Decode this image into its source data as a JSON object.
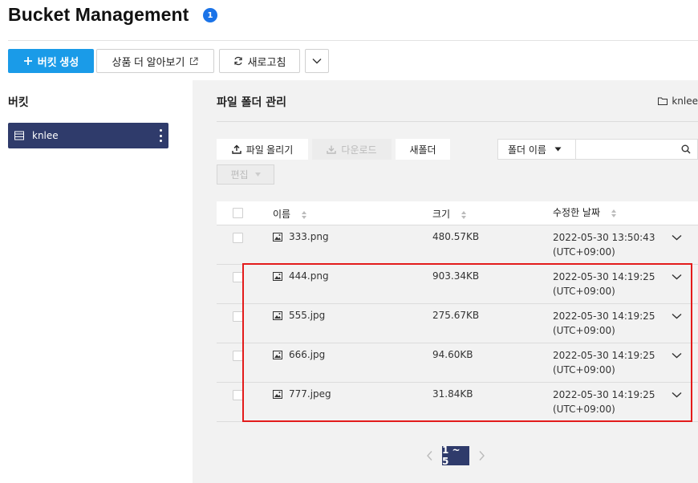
{
  "header": {
    "title": "Bucket Management",
    "badge": "1"
  },
  "toolbar": {
    "create_bucket": "버킷 생성",
    "learn_more": "상품 더 알아보기",
    "refresh": "새로고침"
  },
  "sidebar": {
    "title": "버킷",
    "buckets": [
      {
        "label": "knlee"
      }
    ]
  },
  "main": {
    "title": "파일 폴더 관리",
    "breadcrumb": "knlee",
    "actions": {
      "upload": "파일 올리기",
      "download": "다운로드",
      "new_folder": "새폴더",
      "edit": "편집"
    },
    "search": {
      "filter_label": "폴더 이름",
      "placeholder": ""
    }
  },
  "table": {
    "headers": {
      "name": "이름",
      "size": "크기",
      "modified": "수정한 날짜"
    },
    "rows": [
      {
        "name": "333.png",
        "size": "480.57KB",
        "date": "2022-05-30 13:50:43",
        "tz": "(UTC+09:00)"
      },
      {
        "name": "444.png",
        "size": "903.34KB",
        "date": "2022-05-30 14:19:25",
        "tz": "(UTC+09:00)"
      },
      {
        "name": "555.jpg",
        "size": "275.67KB",
        "date": "2022-05-30 14:19:25",
        "tz": "(UTC+09:00)"
      },
      {
        "name": "666.jpg",
        "size": "94.60KB",
        "date": "2022-05-30 14:19:25",
        "tz": "(UTC+09:00)"
      },
      {
        "name": "777.jpeg",
        "size": "31.84KB",
        "date": "2022-05-30 14:19:25",
        "tz": "(UTC+09:00)"
      }
    ]
  },
  "pagination": {
    "current": "1 ~ 5"
  },
  "colors": {
    "primary": "#1a9be8",
    "navy": "#2f3b6b",
    "highlight": "#e31b1b"
  }
}
